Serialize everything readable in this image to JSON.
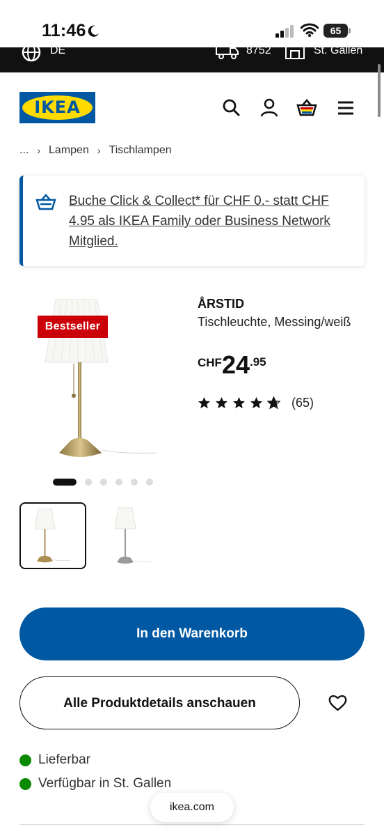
{
  "status_bar": {
    "time": "11:46",
    "battery": "65"
  },
  "top_strip": {
    "language": "DE",
    "zip": "8752",
    "store": "St. Gallen"
  },
  "header": {
    "logo_text": "IKEA"
  },
  "breadcrumb": {
    "ellipsis": "...",
    "items": [
      "Lampen",
      "Tischlampen"
    ]
  },
  "promo": {
    "text": "Buche Click & Collect* für CHF 0.- statt CHF 4.95 als IKEA Family oder Business Network Mitglied."
  },
  "product": {
    "badge": "Bestseller",
    "name": "ÅRSTID",
    "description": "Tischleuchte, Messing/weiß",
    "price": {
      "currency": "CHF",
      "integer": "24",
      "decimal": ".95"
    },
    "rating": {
      "stars": 4.5,
      "count": "(65)"
    },
    "image_pages": {
      "total": 6,
      "active": 1
    }
  },
  "actions": {
    "add_to_cart": "In den Warenkorb",
    "all_details": "Alle Produktdetails anschauen"
  },
  "availability": [
    "Lieferbar",
    "Verfügbar in St. Gallen"
  ],
  "browser": {
    "url": "ikea.com"
  },
  "colors": {
    "ikea_blue": "#0058a3",
    "ikea_yellow": "#ffdb00",
    "badge_red": "#cc0008",
    "available_green": "#0a8a00"
  }
}
